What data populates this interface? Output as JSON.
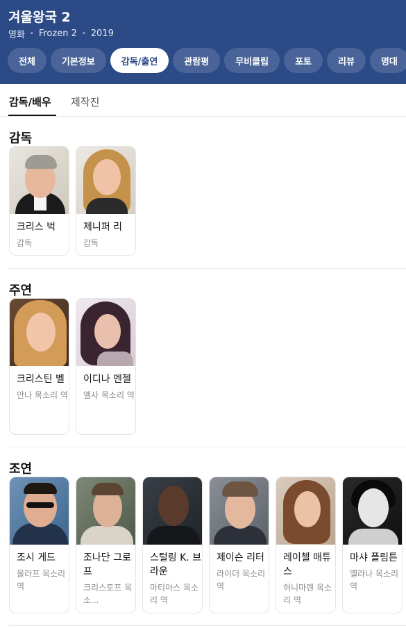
{
  "header": {
    "title": "겨울왕국 2",
    "meta": [
      "영화",
      "Frozen 2",
      "2019"
    ],
    "tabs": [
      "전체",
      "기본정보",
      "감독/출연",
      "관람평",
      "무비클립",
      "포토",
      "리뷰",
      "명대"
    ]
  },
  "subtabs": [
    "감독/배우",
    "제작진"
  ],
  "sections": {
    "director": {
      "title": "감독",
      "people": [
        {
          "name": "크리스 벅",
          "role": "감독"
        },
        {
          "name": "제니퍼 리",
          "role": "감독"
        }
      ]
    },
    "lead": {
      "title": "주연",
      "people": [
        {
          "name": "크리스틴 벨",
          "role": "안나 목소리 역"
        },
        {
          "name": "이디나 멘젤",
          "role": "엘사 목소리 역"
        }
      ]
    },
    "supporting": {
      "title": "조연",
      "people": [
        {
          "name": "조시 게드",
          "role": "올라프 목소리 역"
        },
        {
          "name": "조나단 그로프",
          "role": "크리스토프 목소..."
        },
        {
          "name": "스털링 K. 브라운",
          "role": "마티아스 목소리 역"
        },
        {
          "name": "제이슨 리터",
          "role": "라이더 목소리 역"
        },
        {
          "name": "레이첼 매튜스",
          "role": "허니마렌 목소리 역"
        },
        {
          "name": "마샤 플림튼",
          "role": "옐라나 목소리 역"
        }
      ]
    }
  },
  "colors": {
    "header_bg": "#2c4a86",
    "tab_bg": "#4a6499",
    "active_tab_text": "#2c4a86"
  }
}
